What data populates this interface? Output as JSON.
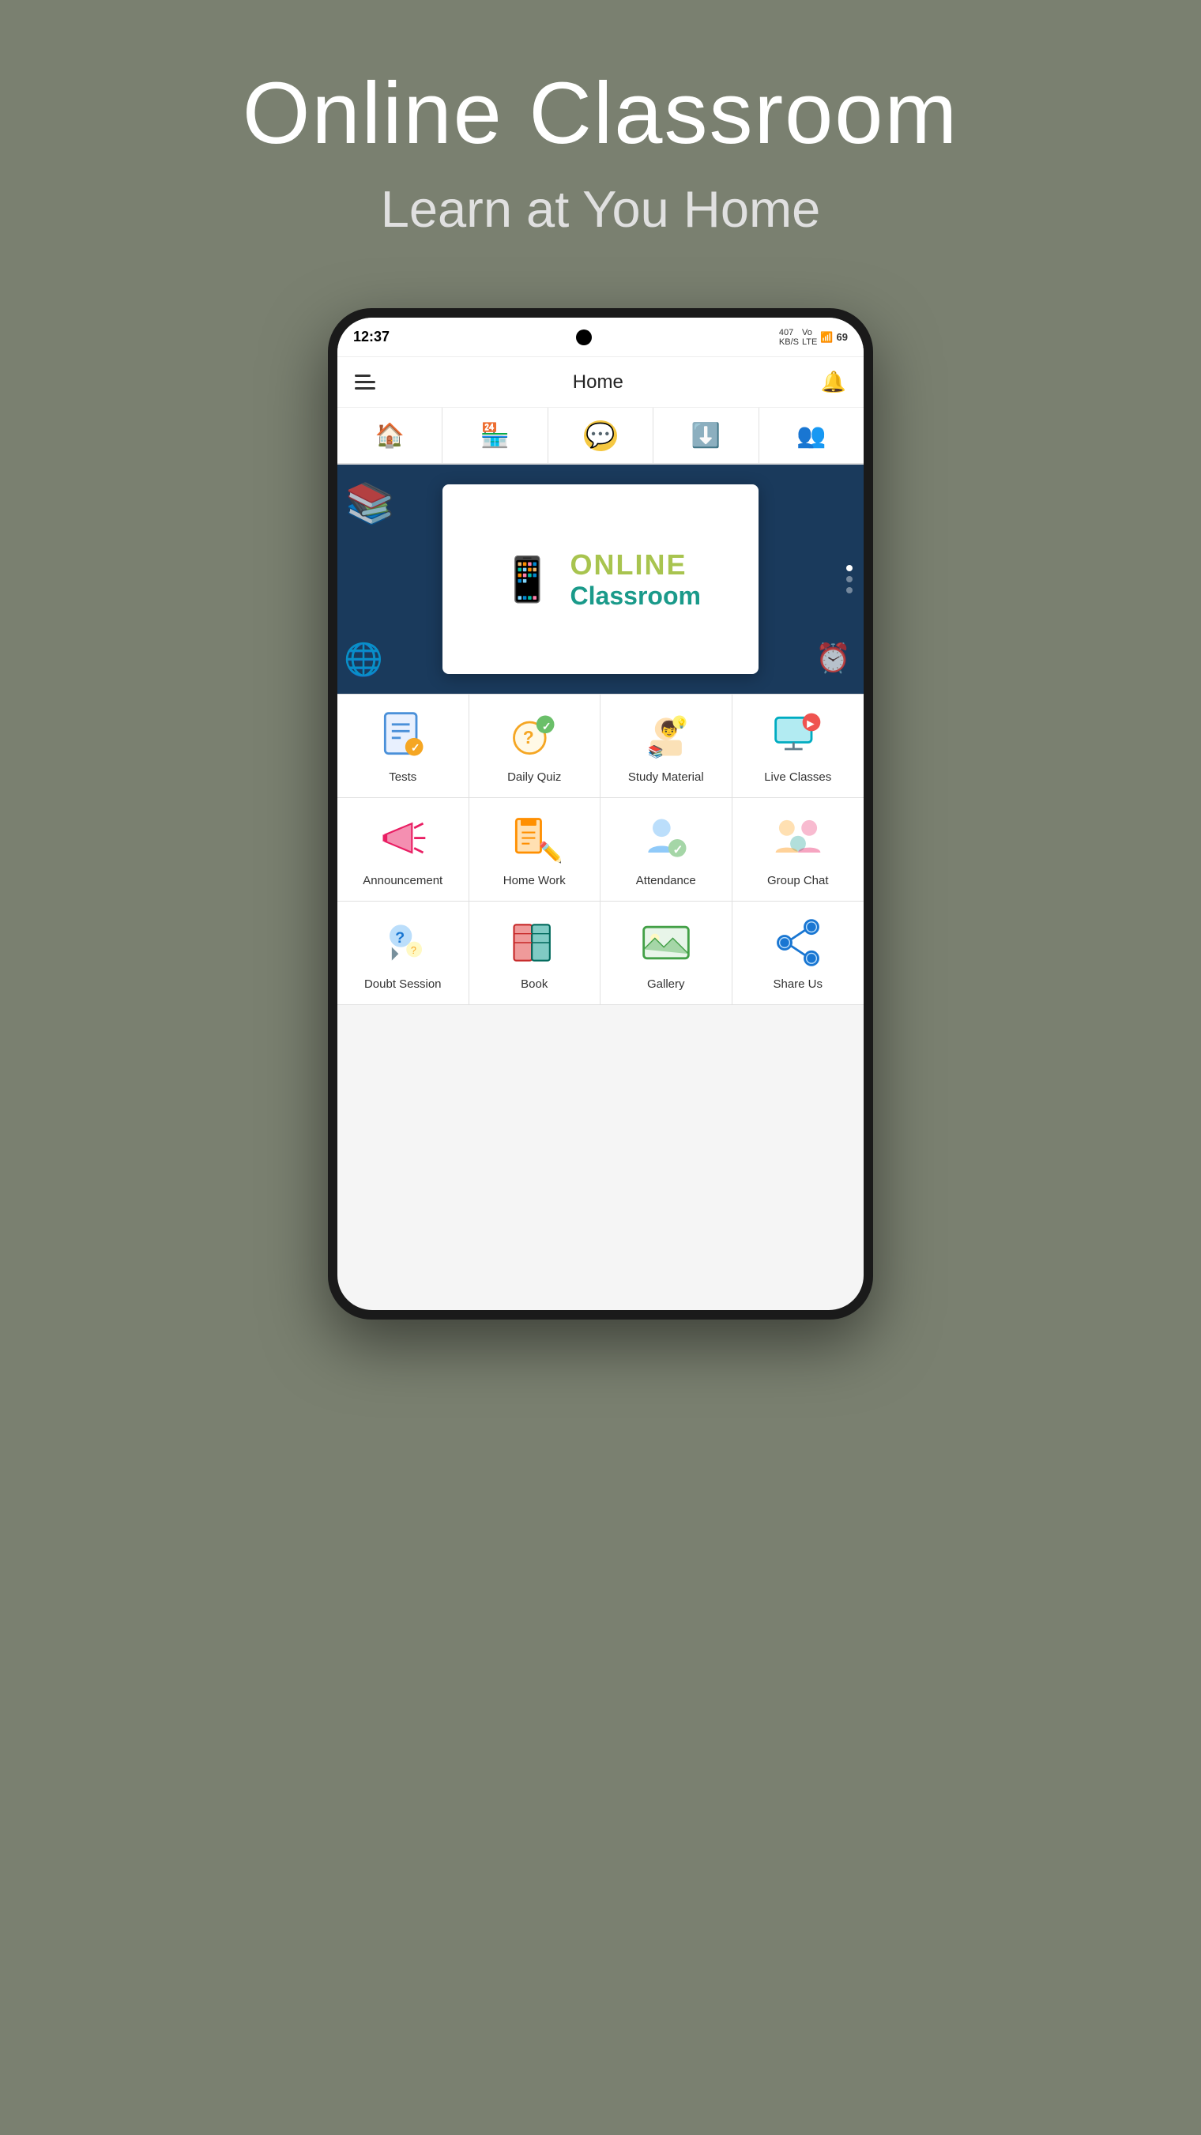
{
  "header": {
    "title": "Online Classroom",
    "subtitle": "Learn at You Home"
  },
  "statusBar": {
    "time": "12:37",
    "signal": "407 KB/S",
    "networkType": "Vo 4G",
    "battery": "69"
  },
  "topNav": {
    "title": "Home"
  },
  "tabs": [
    {
      "id": "home",
      "icon": "🏠",
      "label": "Home"
    },
    {
      "id": "store",
      "icon": "🏪",
      "label": "Store"
    },
    {
      "id": "chat",
      "icon": "💬",
      "label": "Chat"
    },
    {
      "id": "download",
      "icon": "⬇️",
      "label": "Download"
    },
    {
      "id": "profile",
      "icon": "👥",
      "label": "Profile"
    }
  ],
  "banner": {
    "online": "ONLINE",
    "classroom": "Classroom"
  },
  "menuItems": [
    {
      "id": "tests",
      "label": "Tests",
      "icon": "tests"
    },
    {
      "id": "daily-quiz",
      "label": "Daily Quiz",
      "icon": "quiz"
    },
    {
      "id": "study-material",
      "label": "Study Material",
      "icon": "study"
    },
    {
      "id": "live-classes",
      "label": "Live Classes",
      "icon": "live"
    },
    {
      "id": "announcement",
      "label": "Announcement",
      "icon": "announce"
    },
    {
      "id": "home-work",
      "label": "Home Work",
      "icon": "homework"
    },
    {
      "id": "attendance",
      "label": "Attendance",
      "icon": "attendance"
    },
    {
      "id": "group-chat",
      "label": "Group Chat",
      "icon": "groupchat"
    },
    {
      "id": "doubt-session",
      "label": "Doubt Session",
      "icon": "doubt"
    },
    {
      "id": "book",
      "label": "Book",
      "icon": "book"
    },
    {
      "id": "gallery",
      "label": "Gallery",
      "icon": "gallery"
    },
    {
      "id": "share-us",
      "label": "Share Us",
      "icon": "share"
    }
  ],
  "colors": {
    "background": "#7a8070",
    "navBg": "#1a3a5c",
    "accent1": "#a8c44f",
    "accent2": "#1a9a8a"
  }
}
